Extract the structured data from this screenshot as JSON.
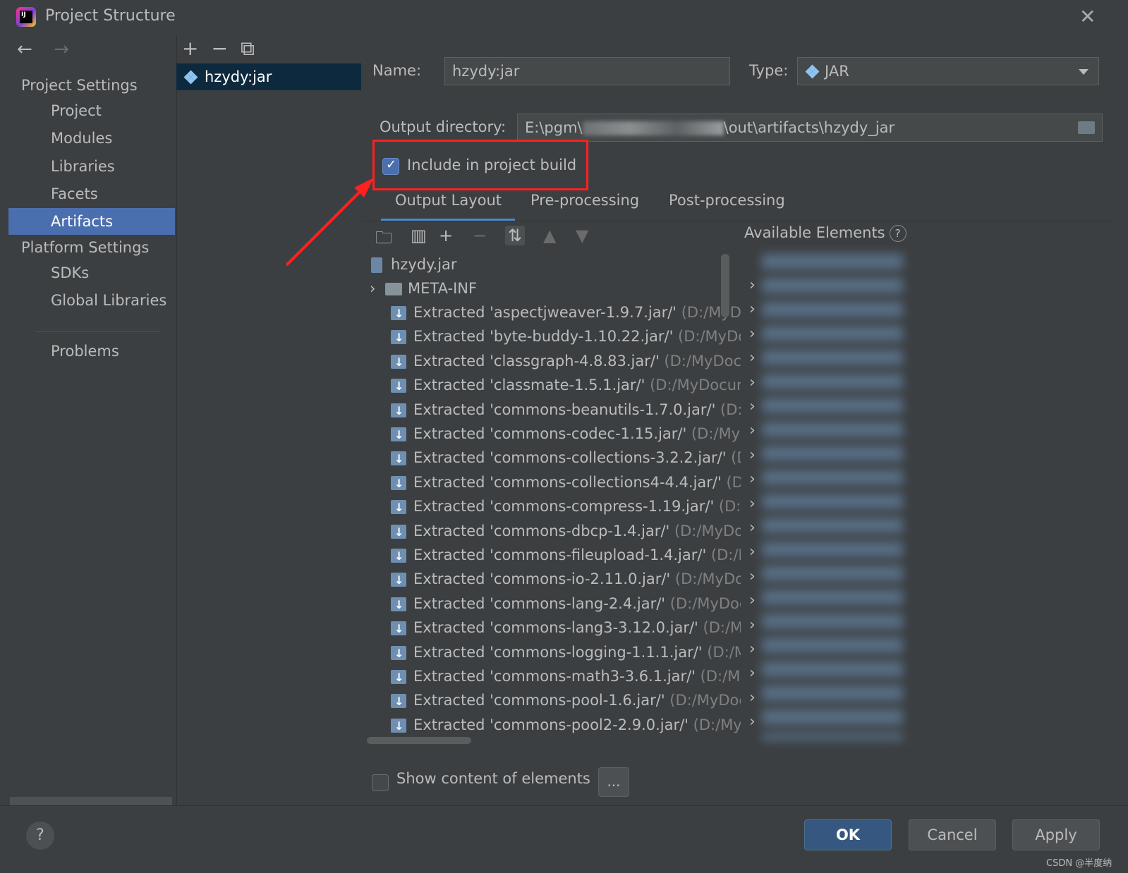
{
  "window": {
    "title": "Project Structure"
  },
  "sidebar": {
    "project_settings": "Project Settings",
    "items": [
      "Project",
      "Modules",
      "Libraries",
      "Facets",
      "Artifacts"
    ],
    "selected": "Artifacts",
    "platform_settings": "Platform Settings",
    "platform_items": [
      "SDKs",
      "Global Libraries"
    ],
    "problems": "Problems"
  },
  "artifacts": {
    "selected": "hzydy:jar"
  },
  "form": {
    "name_label": "Name:",
    "name_value": "hzydy:jar",
    "type_label": "Type:",
    "type_value": "JAR",
    "output_label": "Output directory:",
    "output_prefix": "E:\\pgm\\",
    "output_suffix": "\\out\\artifacts\\hzydy_jar",
    "include_label": "Include in project build",
    "include_checked": true
  },
  "tabs": [
    "Output Layout",
    "Pre-processing",
    "Post-processing"
  ],
  "active_tab": "Output Layout",
  "available_elements": "Available Elements",
  "tree": {
    "root": "hzydy.jar",
    "meta": "META-INF",
    "rows": [
      {
        "name": "Extracted 'aspectjweaver-1.9.7.jar/'",
        "path": " (D:/MyDo"
      },
      {
        "name": "Extracted 'byte-buddy-1.10.22.jar/'",
        "path": " (D:/MyDoc"
      },
      {
        "name": "Extracted 'classgraph-4.8.83.jar/'",
        "path": " (D:/MyDocu"
      },
      {
        "name": "Extracted 'classmate-1.5.1.jar/'",
        "path": " (D:/MyDocume"
      },
      {
        "name": "Extracted 'commons-beanutils-1.7.0.jar/'",
        "path": " (D:/"
      },
      {
        "name": "Extracted 'commons-codec-1.15.jar/'",
        "path": " (D:/MyD"
      },
      {
        "name": "Extracted 'commons-collections-3.2.2.jar/'",
        "path": " (D:"
      },
      {
        "name": "Extracted 'commons-collections4-4.4.jar/'",
        "path": " (D:/"
      },
      {
        "name": "Extracted 'commons-compress-1.19.jar/'",
        "path": " (D:/"
      },
      {
        "name": "Extracted 'commons-dbcp-1.4.jar/'",
        "path": " (D:/MyDoc"
      },
      {
        "name": "Extracted 'commons-fileupload-1.4.jar/'",
        "path": " (D:/M"
      },
      {
        "name": "Extracted 'commons-io-2.11.0.jar/'",
        "path": " (D:/MyDoc"
      },
      {
        "name": "Extracted 'commons-lang-2.4.jar/'",
        "path": " (D:/MyDoc"
      },
      {
        "name": "Extracted 'commons-lang3-3.12.0.jar/'",
        "path": " (D:/My"
      },
      {
        "name": "Extracted 'commons-logging-1.1.1.jar/'",
        "path": " (D:/M"
      },
      {
        "name": "Extracted 'commons-math3-3.6.1.jar/'",
        "path": " (D:/My"
      },
      {
        "name": "Extracted 'commons-pool-1.6.jar/'",
        "path": " (D:/MyDoc"
      },
      {
        "name": "Extracted 'commons-pool2-2.9.0.jar/'",
        "path": " (D:/MyD"
      }
    ]
  },
  "show_content": {
    "label": "Show content of elements",
    "checked": false,
    "more": "..."
  },
  "footer": {
    "help": "?",
    "ok": "OK",
    "cancel": "Cancel",
    "apply": "Apply"
  },
  "watermark": "CSDN @半度纳",
  "colors": {
    "selection": "#4b6eaf",
    "ok": "#365880",
    "highlight": "#ff2020"
  }
}
